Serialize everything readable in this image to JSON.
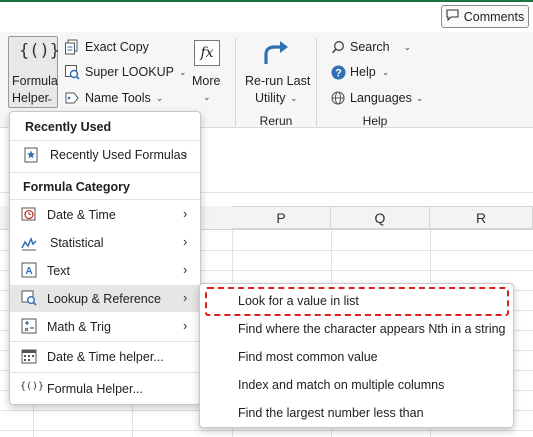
{
  "header": {
    "comments_label": "Comments"
  },
  "ribbon": {
    "formula_helper": {
      "line1": "Formula",
      "line2": "Helper"
    },
    "exact_copy": "Exact Copy",
    "super_lookup": "Super LOOKUP",
    "name_tools": "Name Tools",
    "more": "More",
    "rerun": {
      "line1": "Re-run Last",
      "line2": "Utility",
      "group": "Rerun"
    },
    "search": "Search",
    "help": "Help",
    "languages": "Languages",
    "help_group": "Help"
  },
  "sheet": {
    "columns": [
      "P",
      "Q",
      "R"
    ]
  },
  "menu": {
    "recently_used_header": "Recently Used",
    "recently_used_formulas": "Recently Used Formulas",
    "category_header": "Formula Category",
    "date_time": "Date & Time",
    "statistical": "Statistical",
    "text": "Text",
    "lookup_reference": "Lookup & Reference",
    "math_trig": "Math & Trig",
    "date_time_helper": "Date & Time helper...",
    "formula_helper": "Formula Helper..."
  },
  "submenu": {
    "items": [
      "Look for a value in list",
      "Find where the character appears Nth in a string",
      "Find most common value",
      "Index and match on multiple columns",
      "Find the largest number less than"
    ]
  },
  "colors": {
    "accent_green": "#1e7145",
    "highlight_red": "#e01e1e",
    "icon_blue": "#2f6fb3"
  }
}
